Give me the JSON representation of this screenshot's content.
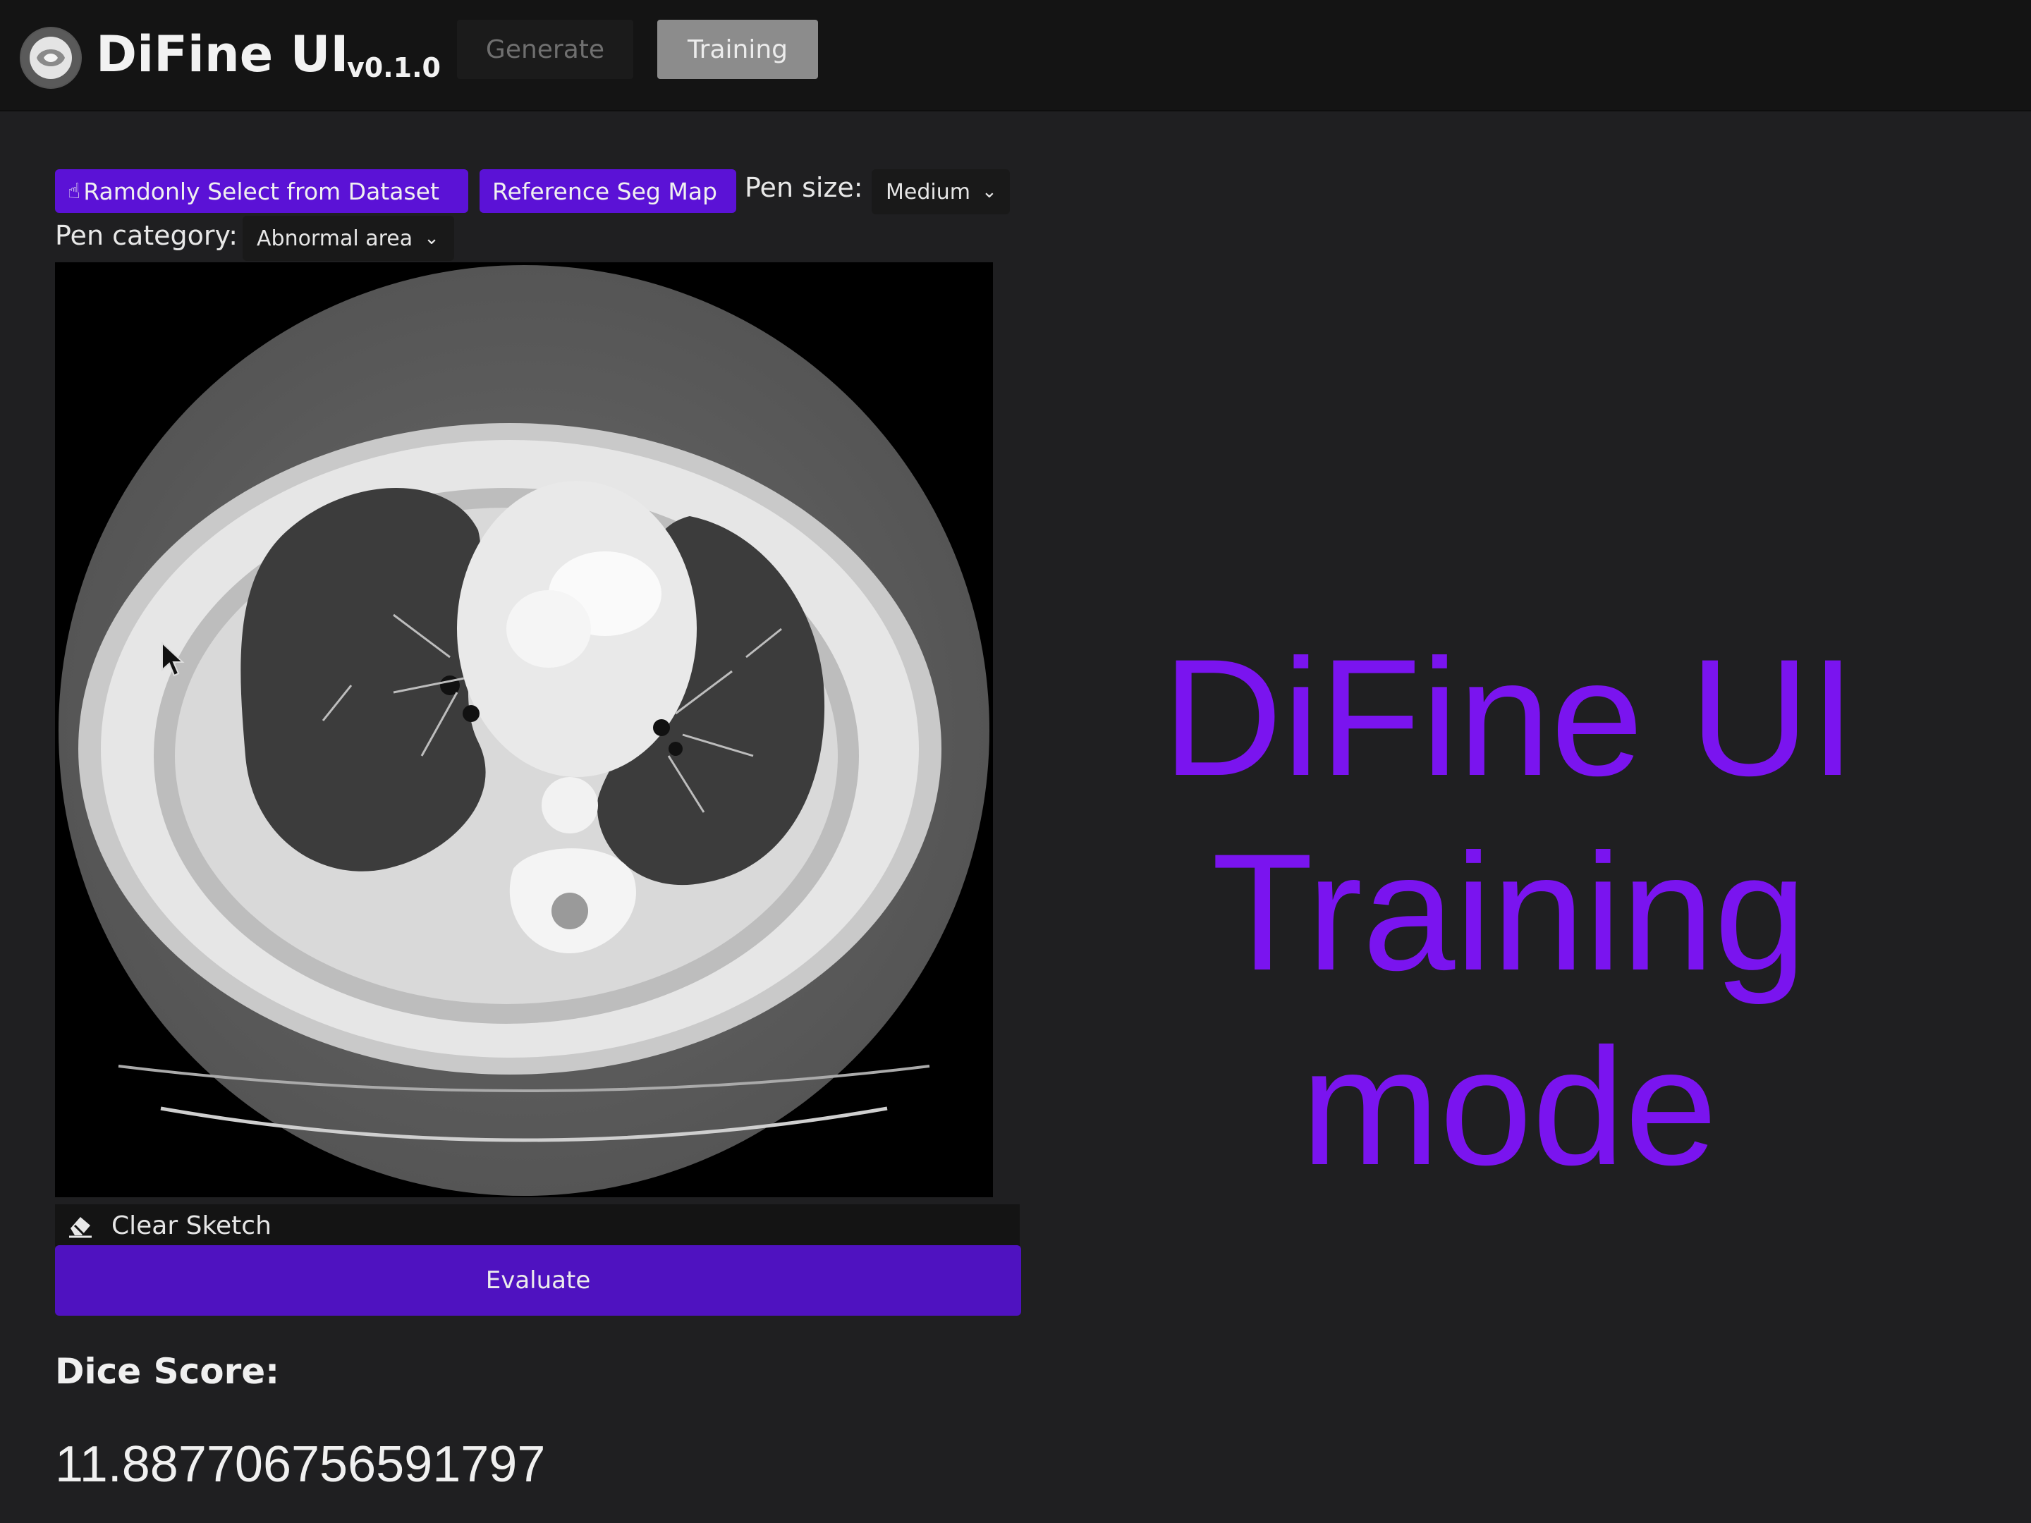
{
  "header": {
    "app_name": "DiFine UI",
    "version": "v0.1.0",
    "tabs": [
      {
        "label": "Generate",
        "active": false
      },
      {
        "label": "Training",
        "active": true
      }
    ]
  },
  "toolbar": {
    "random_select_label": "Ramdonly Select from Dataset",
    "reference_seg_label": "Reference Seg Map",
    "pen_size_label": "Pen size:",
    "pen_size_value": "Medium",
    "pen_category_label": "Pen category:",
    "pen_category_value": "Abnormal area"
  },
  "canvas": {
    "image_description_name": "ct-scan-image"
  },
  "actions": {
    "clear_sketch_label": "Clear Sketch",
    "evaluate_label": "Evaluate"
  },
  "result": {
    "dice_label": "Dice Score:",
    "dice_value": "11.887706756591797"
  },
  "overlay": {
    "line1": "DiFine UI",
    "line2": "Training mode"
  },
  "colors": {
    "accent": "#5b12d6",
    "overlay_text": "#7a14ef",
    "background": "#1f1f21"
  }
}
